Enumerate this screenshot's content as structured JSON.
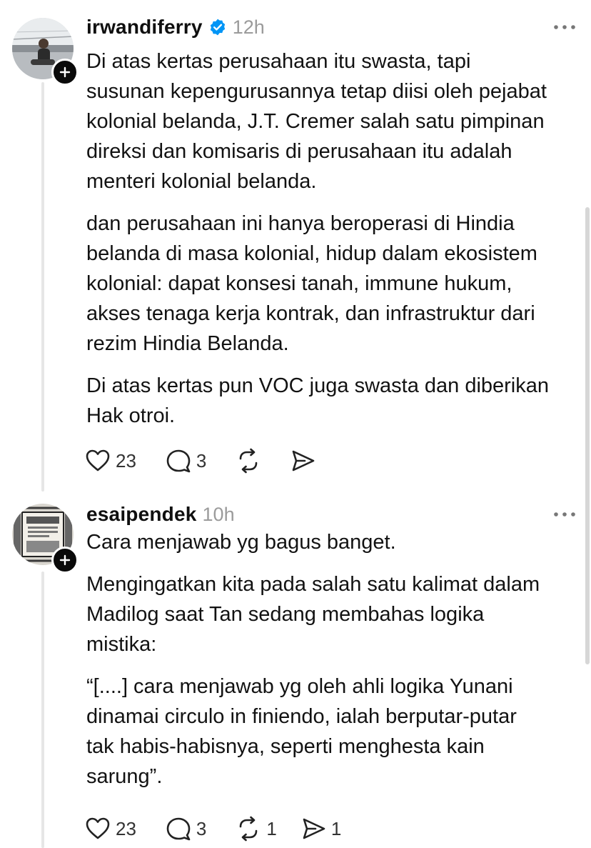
{
  "posts": [
    {
      "username": "irwandiferry",
      "verified": true,
      "timestamp": "12h",
      "paragraphs": [
        "Di atas kertas perusahaan itu swasta, tapi\nsusunan kepengurusannya tetap diisi oleh pejabat\nkolonial belanda, J.T. Cremer salah satu pimpinan\ndireksi dan komisaris di perusahaan itu adalah\nmenteri kolonial belanda.",
        "dan perusahaan ini hanya beroperasi di Hindia\nbelanda di masa kolonial, hidup dalam ekosistem\nkolonial: dapat konsesi tanah, immune hukum,\nakses tenaga kerja kontrak, dan infrastruktur dari\nrezim Hindia Belanda.",
        "Di atas kertas pun VOC juga swasta dan diberikan\nHak otroi."
      ],
      "likes": "23",
      "comments": "3",
      "reposts": "",
      "shares": ""
    },
    {
      "username": "esaipendek",
      "verified": false,
      "timestamp": "10h",
      "paragraphs": [
        "Cara menjawab yg bagus banget.",
        "Mengingatkan kita pada salah satu kalimat dalam\nMadilog saat Tan sedang membahas logika\nmistika:",
        "“[....] cara menjawab yg oleh ahli logika Yunani\ndinamai circulo in finiendo, ialah berputar-putar\ntak habis-habisnya, seperti menghesta kain\nsarung”."
      ],
      "likes": "23",
      "comments": "3",
      "reposts": "1",
      "shares": "1"
    }
  ],
  "icons": {
    "like": "heart-icon",
    "comment": "comment-bubble-icon",
    "repost": "repost-icon",
    "share": "send-icon",
    "more": "more-dots-icon",
    "verified": "verified-badge-icon",
    "follow": "plus-icon"
  },
  "colors": {
    "verified": "#0095f6",
    "muted": "#9b9b9b",
    "text": "#121212"
  }
}
